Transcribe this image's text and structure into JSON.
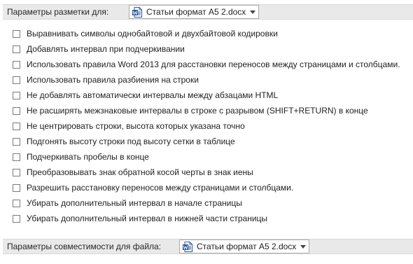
{
  "layout_options": {
    "header_label": "Параметры разметки для:",
    "document": "Статьи формат А5 2.docx",
    "items": [
      {
        "label": "Выравнивать символы однобайтовой и двухбайтовой кодировки",
        "checked": false
      },
      {
        "label": "Добавлять интервал при подчеркивании",
        "checked": false
      },
      {
        "label": "Использовать правила Word 2013 для расстановки переносов между страницами и столбцами.",
        "checked": false
      },
      {
        "label": "Использовать правила разбиения на строки",
        "checked": false
      },
      {
        "label": "Не добавлять автоматически интервалы между абзацами HTML",
        "checked": false
      },
      {
        "label": "Не расширять межзнаковые интервалы в строке с разрывом (SHIFT+RETURN) в конце",
        "checked": false
      },
      {
        "label": "Не центрировать строки, высота которых указана точно",
        "checked": false
      },
      {
        "label": "Подгонять высоту строки под высоту сетки в таблице",
        "checked": false
      },
      {
        "label": "Подчеркивать пробелы в конце",
        "checked": false
      },
      {
        "label": "Преобразовывать знак обратной косой черты в знак иены",
        "checked": false
      },
      {
        "label": "Разрешить расстановку переносов между страницами и столбцами.",
        "checked": false
      },
      {
        "label": "Убирать дополнительный интервал в начале страницы",
        "checked": false
      },
      {
        "label": "Убирать дополнительный интервал в нижней части страницы",
        "checked": false
      }
    ]
  },
  "compatibility": {
    "header_label": "Параметры совместимости для файла:",
    "document": "Статьи формат А5 2.docx"
  },
  "icons": {
    "document_icon": "word-document-icon",
    "dropdown_icon": "chevron-down-icon"
  },
  "colors": {
    "header_background": "#e9e9e9",
    "word_blue": "#2b579a"
  }
}
